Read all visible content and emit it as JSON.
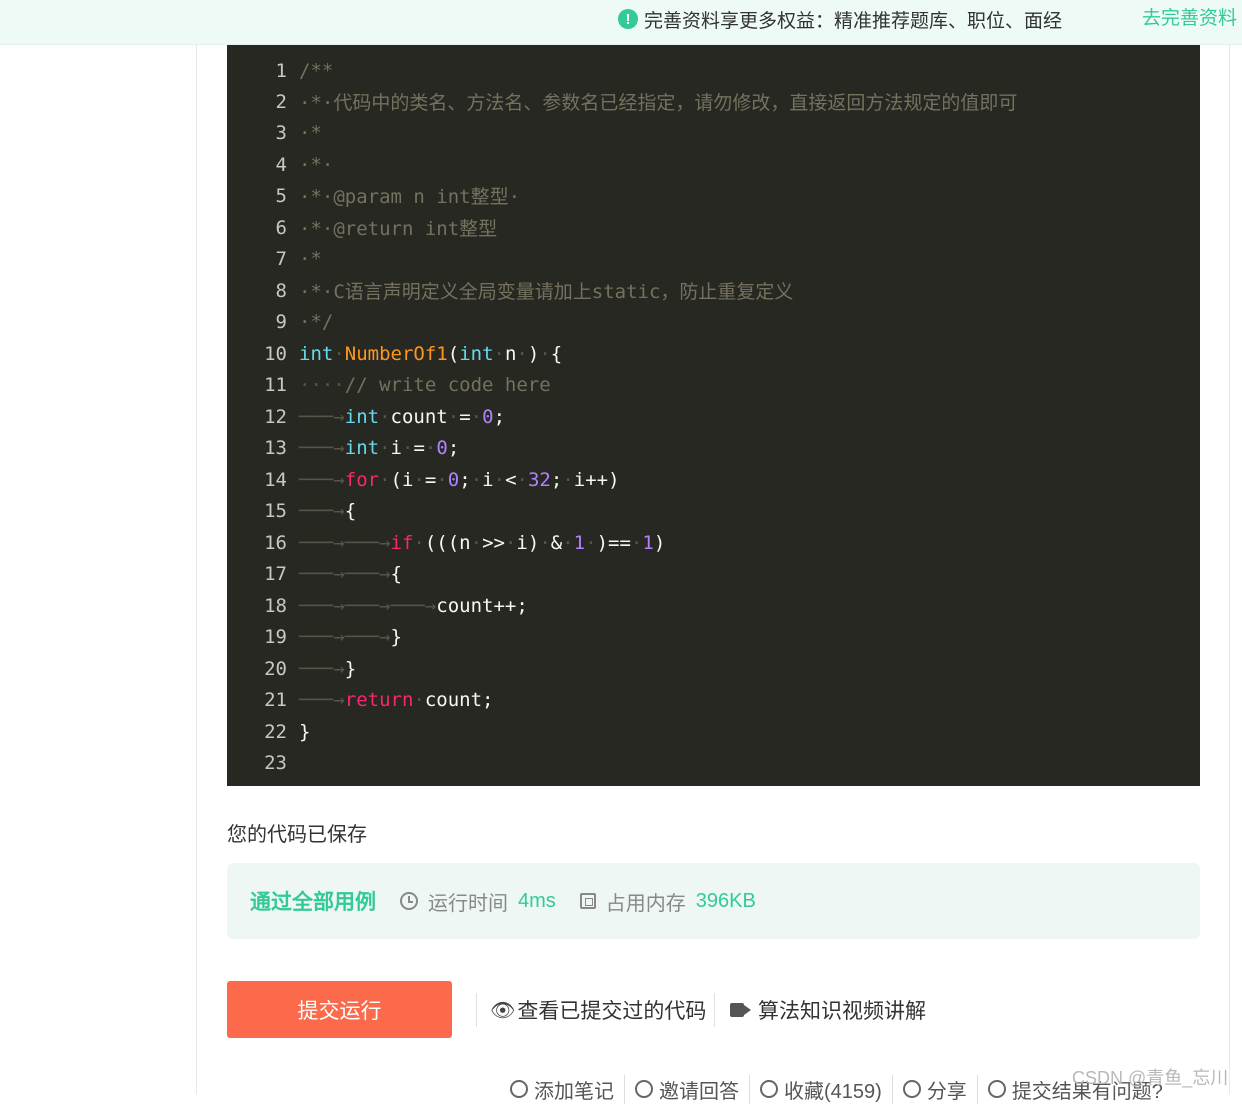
{
  "topbar": {
    "notice_icon": "!",
    "notice_text": "完善资料享更多权益：精准推荐题库、职位、面经",
    "cta": "去完善资料"
  },
  "editor": {
    "lines": [
      {
        "n": "1"
      },
      {
        "n": "2"
      },
      {
        "n": "3"
      },
      {
        "n": "4"
      },
      {
        "n": "5"
      },
      {
        "n": "6"
      },
      {
        "n": "7"
      },
      {
        "n": "8"
      },
      {
        "n": "9"
      },
      {
        "n": "10"
      },
      {
        "n": "11"
      },
      {
        "n": "12"
      },
      {
        "n": "13"
      },
      {
        "n": "14"
      },
      {
        "n": "15"
      },
      {
        "n": "16"
      },
      {
        "n": "17"
      },
      {
        "n": "18"
      },
      {
        "n": "19"
      },
      {
        "n": "20"
      },
      {
        "n": "21"
      },
      {
        "n": "22"
      },
      {
        "n": "23"
      }
    ],
    "comment_2": "代码中的类名、方法名、参数名已经指定，请勿修改，直接返回方法规定的值即可",
    "comment_5": "@param n int整型",
    "comment_6": "@return int整型",
    "comment_8": "C语言声明定义全局变量请加上static，防止重复定义",
    "comment_11": "// write code here"
  },
  "status": {
    "saved": "您的代码已保存",
    "pass": "通过全部用例",
    "runtime_label": "运行时间",
    "runtime_value": "4ms",
    "memory_label": "占用内存",
    "memory_value": "396KB"
  },
  "actions": {
    "submit": "提交运行",
    "view_submitted": "查看已提交过的代码",
    "video": "算法知识视频讲解"
  },
  "bottom_tools": {
    "note": "添加笔记",
    "invite": "邀请回答",
    "favorite": "收藏(4159)",
    "share": "分享",
    "question": "提交结果有问题?"
  },
  "watermark": "CSDN @青鱼_忘川"
}
